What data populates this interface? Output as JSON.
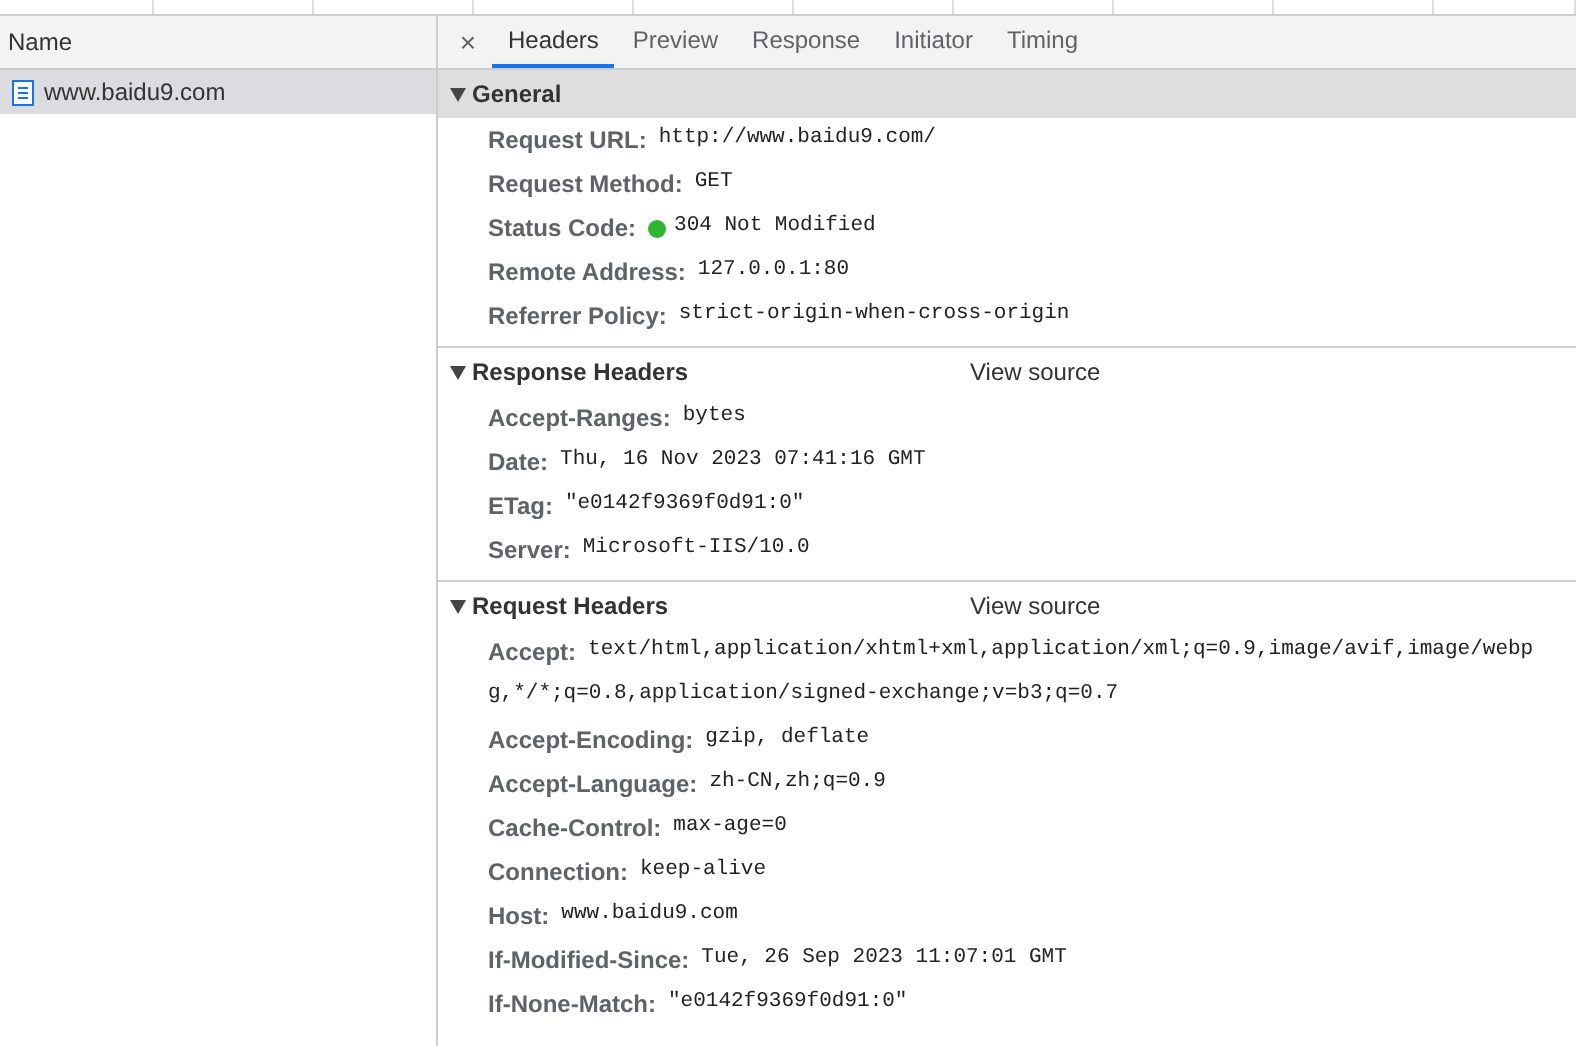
{
  "request_list": {
    "column": "Name",
    "items": [
      {
        "name": "www.baidu9.com",
        "selected": true
      }
    ]
  },
  "detail_tabs": [
    {
      "label": "Headers",
      "selected": true
    },
    {
      "label": "Preview",
      "selected": false
    },
    {
      "label": "Response",
      "selected": false
    },
    {
      "label": "Initiator",
      "selected": false
    },
    {
      "label": "Timing",
      "selected": false
    }
  ],
  "close_symbol": "×",
  "sections": [
    {
      "title": "General",
      "expanded": true,
      "selected": true,
      "rows": [
        {
          "label": "Request URL:",
          "value": [
            "http://www.baidu9.com/"
          ]
        },
        {
          "label": "Request Method:",
          "value": [
            "GET"
          ]
        },
        {
          "label": "Status Code:",
          "value": [
            "304 Not Modified"
          ],
          "color": "#2fb52f"
        },
        {
          "label": "Remote Address:",
          "value": [
            "127.0.0.1:80"
          ]
        },
        {
          "label": "Referrer Policy:",
          "value": [
            "strict-origin-when-cross-origin"
          ]
        }
      ]
    },
    {
      "title": "Response Headers",
      "expanded": true,
      "selected": false,
      "link": "View source",
      "rows": [
        {
          "label": "Accept-Ranges:",
          "value": [
            "bytes"
          ]
        },
        {
          "label": "Date:",
          "value": [
            "Thu, 16 Nov 2023 07:41:16 GMT"
          ]
        },
        {
          "label": "ETag:",
          "value": [
            "\"e0142f9369f0d91:0\""
          ]
        },
        {
          "label": "Server:",
          "value": [
            "Microsoft-IIS/10.0"
          ]
        }
      ]
    },
    {
      "title": "Request Headers",
      "expanded": true,
      "selected": false,
      "link": "View source",
      "rows": [
        {
          "label": "Accept:",
          "value": [
            "text/html,application/xhtml+xml,application/xml;q=0.9,image/avif,image/webp",
            "g,*/*;q=0.8,application/signed-exchange;v=b3;q=0.7"
          ]
        },
        {
          "label": "Accept-Encoding:",
          "value": [
            "gzip, deflate"
          ]
        },
        {
          "label": "Accept-Language:",
          "value": [
            "zh-CN,zh;q=0.9"
          ]
        },
        {
          "label": "Cache-Control:",
          "value": [
            "max-age=0"
          ]
        },
        {
          "label": "Connection:",
          "value": [
            "keep-alive"
          ]
        },
        {
          "label": "Host:",
          "value": [
            "www.baidu9.com"
          ]
        },
        {
          "label": "If-Modified-Since:",
          "value": [
            "Tue, 26 Sep 2023 11:07:01 GMT"
          ]
        },
        {
          "label": "If-None-Match:",
          "value": [
            "\"e0142f9369f0d91:0\""
          ]
        }
      ]
    }
  ]
}
